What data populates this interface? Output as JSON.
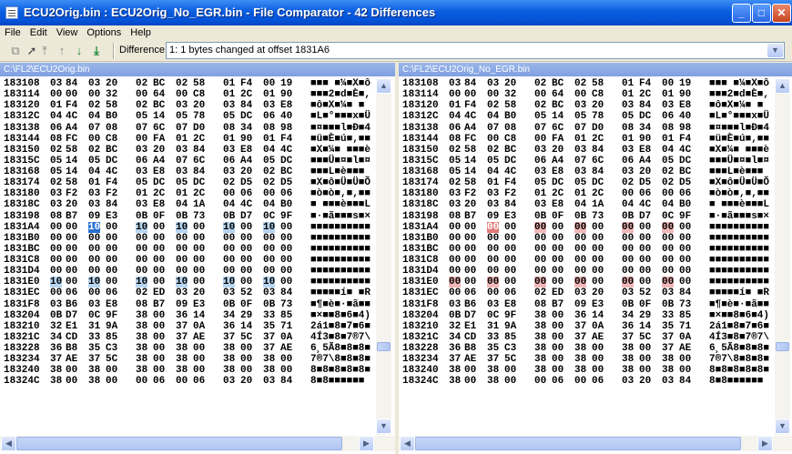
{
  "window": {
    "title": "ECU2Orig.bin : ECU2Orig_No_EGR.bin - File Comparator - 42 Differences"
  },
  "menu": [
    "File",
    "Edit",
    "View",
    "Options",
    "Help"
  ],
  "toolbar": {
    "difference_label": "Difference",
    "difference_value": "1: 1 bytes changed at offset 1831A6"
  },
  "left": {
    "path": "C:\\FL2\\ECU2Orig.bin",
    "rows": [
      {
        "addr": "183108",
        "bytes": [
          "03",
          "84",
          "03",
          "20",
          "02",
          "BC",
          "02",
          "58",
          "01",
          "F4",
          "00",
          "19"
        ],
        "ascii": "■■■ ■¼■X■ô"
      },
      {
        "addr": "183114",
        "bytes": [
          "00",
          "00",
          "00",
          "32",
          "00",
          "64",
          "00",
          "C8",
          "01",
          "2C",
          "01",
          "90"
        ],
        "ascii": "■■■2■d■È■,"
      },
      {
        "addr": "183120",
        "bytes": [
          "01",
          "F4",
          "02",
          "58",
          "02",
          "BC",
          "03",
          "20",
          "03",
          "84",
          "03",
          "E8"
        ],
        "ascii": "■ô■X■¼■ ■"
      },
      {
        "addr": "18312C",
        "bytes": [
          "04",
          "4C",
          "04",
          "B0",
          "05",
          "14",
          "05",
          "78",
          "05",
          "DC",
          "06",
          "40"
        ],
        "ascii": "■L■°■■■x■Ü"
      },
      {
        "addr": "183138",
        "bytes": [
          "06",
          "A4",
          "07",
          "08",
          "07",
          "6C",
          "07",
          "D0",
          "08",
          "34",
          "08",
          "98"
        ],
        "ascii": "■¤■■■l■Ð■4"
      },
      {
        "addr": "183144",
        "bytes": [
          "08",
          "FC",
          "00",
          "C8",
          "00",
          "FA",
          "01",
          "2C",
          "01",
          "90",
          "01",
          "F4"
        ],
        "ascii": "■ü■È■ú■,■■"
      },
      {
        "addr": "183150",
        "bytes": [
          "02",
          "58",
          "02",
          "BC",
          "03",
          "20",
          "03",
          "84",
          "03",
          "E8",
          "04",
          "4C"
        ],
        "ascii": "■X■¼■ ■■■è"
      },
      {
        "addr": "18315C",
        "bytes": [
          "05",
          "14",
          "05",
          "DC",
          "06",
          "A4",
          "07",
          "6C",
          "06",
          "A4",
          "05",
          "DC"
        ],
        "ascii": "■■■Ü■¤■l■¤"
      },
      {
        "addr": "183168",
        "bytes": [
          "05",
          "14",
          "04",
          "4C",
          "03",
          "E8",
          "03",
          "84",
          "03",
          "20",
          "02",
          "BC"
        ],
        "ascii": "■■■L■è■■■ "
      },
      {
        "addr": "183174",
        "bytes": [
          "02",
          "58",
          "01",
          "F4",
          "05",
          "DC",
          "05",
          "DC",
          "02",
          "D5",
          "02",
          "D5"
        ],
        "ascii": "■X■ô■Ü■Ü■Õ"
      },
      {
        "addr": "183180",
        "bytes": [
          "03",
          "F2",
          "03",
          "F2",
          "01",
          "2C",
          "01",
          "2C",
          "00",
          "06",
          "00",
          "06"
        ],
        "ascii": "■ò■ò■,■,■■"
      },
      {
        "addr": "18318C",
        "bytes": [
          "03",
          "20",
          "03",
          "84",
          "03",
          "E8",
          "04",
          "1A",
          "04",
          "4C",
          "04",
          "B0"
        ],
        "ascii": "■ ■■■è■■■L"
      },
      {
        "addr": "183198",
        "bytes": [
          "08",
          "B7",
          "09",
          "E3",
          "0B",
          "0F",
          "0B",
          "73",
          "0B",
          "D7",
          "0C",
          "9F"
        ],
        "ascii": "■·■ã■■■s■×"
      },
      {
        "addr": "1831A4",
        "bytes": [
          "00",
          "00",
          "10",
          "00",
          "10",
          "00",
          "10",
          "00",
          "10",
          "00",
          "10",
          "00"
        ],
        "ascii": "■■■■■■■■■■"
      },
      {
        "addr": "1831B0",
        "bytes": [
          "00",
          "00",
          "00",
          "00",
          "00",
          "00",
          "00",
          "00",
          "00",
          "00",
          "00",
          "00"
        ],
        "ascii": "■■■■■■■■■■"
      },
      {
        "addr": "1831BC",
        "bytes": [
          "00",
          "00",
          "00",
          "00",
          "00",
          "00",
          "00",
          "00",
          "00",
          "00",
          "00",
          "00"
        ],
        "ascii": "■■■■■■■■■■"
      },
      {
        "addr": "1831C8",
        "bytes": [
          "00",
          "00",
          "00",
          "00",
          "00",
          "00",
          "00",
          "00",
          "00",
          "00",
          "00",
          "00"
        ],
        "ascii": "■■■■■■■■■■"
      },
      {
        "addr": "1831D4",
        "bytes": [
          "00",
          "00",
          "00",
          "00",
          "00",
          "00",
          "00",
          "00",
          "00",
          "00",
          "00",
          "00"
        ],
        "ascii": "■■■■■■■■■■"
      },
      {
        "addr": "1831E0",
        "bytes": [
          "10",
          "00",
          "10",
          "00",
          "10",
          "00",
          "10",
          "00",
          "10",
          "00",
          "10",
          "00"
        ],
        "ascii": "■■■■■■■■■■"
      },
      {
        "addr": "1831EC",
        "bytes": [
          "00",
          "06",
          "00",
          "06",
          "02",
          "ED",
          "03",
          "20",
          "03",
          "52",
          "03",
          "84"
        ],
        "ascii": "■■■■■í■ ■R"
      },
      {
        "addr": "1831F8",
        "bytes": [
          "03",
          "B6",
          "03",
          "E8",
          "08",
          "B7",
          "09",
          "E3",
          "0B",
          "0F",
          "0B",
          "73"
        ],
        "ascii": "■¶■è■·■ã■■"
      },
      {
        "addr": "183204",
        "bytes": [
          "0B",
          "D7",
          "0C",
          "9F",
          "38",
          "00",
          "36",
          "14",
          "34",
          "29",
          "33",
          "85"
        ],
        "ascii": "■×■■8■6■4)"
      },
      {
        "addr": "183210",
        "bytes": [
          "32",
          "E1",
          "31",
          "9A",
          "38",
          "00",
          "37",
          "0A",
          "36",
          "14",
          "35",
          "71"
        ],
        "ascii": "2á1■8■7■6■"
      },
      {
        "addr": "18321C",
        "bytes": [
          "34",
          "CD",
          "33",
          "85",
          "38",
          "00",
          "37",
          "AE",
          "37",
          "5C",
          "37",
          "0A"
        ],
        "ascii": "4Í3■8■7®7\\"
      },
      {
        "addr": "183228",
        "bytes": [
          "36",
          "B8",
          "35",
          "C3",
          "38",
          "00",
          "38",
          "00",
          "38",
          "00",
          "37",
          "AE"
        ],
        "ascii": "6¸5Ã8■8■8■"
      },
      {
        "addr": "183234",
        "bytes": [
          "37",
          "AE",
          "37",
          "5C",
          "38",
          "00",
          "38",
          "00",
          "38",
          "00",
          "38",
          "00"
        ],
        "ascii": "7®7\\8■8■8■"
      },
      {
        "addr": "183240",
        "bytes": [
          "38",
          "00",
          "38",
          "00",
          "38",
          "00",
          "38",
          "00",
          "38",
          "00",
          "38",
          "00"
        ],
        "ascii": "8■8■8■8■8■"
      },
      {
        "addr": "18324C",
        "bytes": [
          "38",
          "00",
          "38",
          "00",
          "00",
          "06",
          "00",
          "06",
          "03",
          "20",
          "03",
          "84"
        ],
        "ascii": "8■8■■■■■■ "
      }
    ]
  },
  "right": {
    "path": "C:\\FL2\\ECU2Orig_No_EGR.bin",
    "rows": [
      {
        "addr": "183108",
        "bytes": [
          "03",
          "84",
          "03",
          "20",
          "02",
          "BC",
          "02",
          "58",
          "01",
          "F4",
          "00",
          "19"
        ],
        "ascii": "■■■ ■¼■X■ô"
      },
      {
        "addr": "183114",
        "bytes": [
          "00",
          "00",
          "00",
          "32",
          "00",
          "64",
          "00",
          "C8",
          "01",
          "2C",
          "01",
          "90"
        ],
        "ascii": "■■■2■d■È■,"
      },
      {
        "addr": "183120",
        "bytes": [
          "01",
          "F4",
          "02",
          "58",
          "02",
          "BC",
          "03",
          "20",
          "03",
          "84",
          "03",
          "E8"
        ],
        "ascii": "■ô■X■¼■ ■"
      },
      {
        "addr": "18312C",
        "bytes": [
          "04",
          "4C",
          "04",
          "B0",
          "05",
          "14",
          "05",
          "78",
          "05",
          "DC",
          "06",
          "40"
        ],
        "ascii": "■L■°■■■x■Ü"
      },
      {
        "addr": "183138",
        "bytes": [
          "06",
          "A4",
          "07",
          "08",
          "07",
          "6C",
          "07",
          "D0",
          "08",
          "34",
          "08",
          "98"
        ],
        "ascii": "■¤■■■l■Ð■4"
      },
      {
        "addr": "183144",
        "bytes": [
          "08",
          "FC",
          "00",
          "C8",
          "00",
          "FA",
          "01",
          "2C",
          "01",
          "90",
          "01",
          "F4"
        ],
        "ascii": "■ü■È■ú■,■■"
      },
      {
        "addr": "183150",
        "bytes": [
          "02",
          "58",
          "02",
          "BC",
          "03",
          "20",
          "03",
          "84",
          "03",
          "E8",
          "04",
          "4C"
        ],
        "ascii": "■X■¼■ ■■■è"
      },
      {
        "addr": "18315C",
        "bytes": [
          "05",
          "14",
          "05",
          "DC",
          "06",
          "A4",
          "07",
          "6C",
          "06",
          "A4",
          "05",
          "DC"
        ],
        "ascii": "■■■Ü■¤■l■¤"
      },
      {
        "addr": "183168",
        "bytes": [
          "05",
          "14",
          "04",
          "4C",
          "03",
          "E8",
          "03",
          "84",
          "03",
          "20",
          "02",
          "BC"
        ],
        "ascii": "■■■L■è■■■ "
      },
      {
        "addr": "183174",
        "bytes": [
          "02",
          "58",
          "01",
          "F4",
          "05",
          "DC",
          "05",
          "DC",
          "02",
          "D5",
          "02",
          "D5"
        ],
        "ascii": "■X■ô■Ü■Ü■Õ"
      },
      {
        "addr": "183180",
        "bytes": [
          "03",
          "F2",
          "03",
          "F2",
          "01",
          "2C",
          "01",
          "2C",
          "00",
          "06",
          "00",
          "06"
        ],
        "ascii": "■ò■ò■,■,■■"
      },
      {
        "addr": "18318C",
        "bytes": [
          "03",
          "20",
          "03",
          "84",
          "03",
          "E8",
          "04",
          "1A",
          "04",
          "4C",
          "04",
          "B0"
        ],
        "ascii": "■ ■■■è■■■L"
      },
      {
        "addr": "183198",
        "bytes": [
          "08",
          "B7",
          "09",
          "E3",
          "0B",
          "0F",
          "0B",
          "73",
          "0B",
          "D7",
          "0C",
          "9F"
        ],
        "ascii": "■·■ã■■■s■×"
      },
      {
        "addr": "1831A4",
        "bytes": [
          "00",
          "00",
          "00",
          "00",
          "00",
          "00",
          "00",
          "00",
          "00",
          "00",
          "00",
          "00"
        ],
        "ascii": "■■■■■■■■■■"
      },
      {
        "addr": "1831B0",
        "bytes": [
          "00",
          "00",
          "00",
          "00",
          "00",
          "00",
          "00",
          "00",
          "00",
          "00",
          "00",
          "00"
        ],
        "ascii": "■■■■■■■■■■"
      },
      {
        "addr": "1831BC",
        "bytes": [
          "00",
          "00",
          "00",
          "00",
          "00",
          "00",
          "00",
          "00",
          "00",
          "00",
          "00",
          "00"
        ],
        "ascii": "■■■■■■■■■■"
      },
      {
        "addr": "1831C8",
        "bytes": [
          "00",
          "00",
          "00",
          "00",
          "00",
          "00",
          "00",
          "00",
          "00",
          "00",
          "00",
          "00"
        ],
        "ascii": "■■■■■■■■■■"
      },
      {
        "addr": "1831D4",
        "bytes": [
          "00",
          "00",
          "00",
          "00",
          "00",
          "00",
          "00",
          "00",
          "00",
          "00",
          "00",
          "00"
        ],
        "ascii": "■■■■■■■■■■"
      },
      {
        "addr": "1831E0",
        "bytes": [
          "00",
          "00",
          "00",
          "00",
          "00",
          "00",
          "00",
          "00",
          "00",
          "00",
          "00",
          "00"
        ],
        "ascii": "■■■■■■■■■■"
      },
      {
        "addr": "1831EC",
        "bytes": [
          "00",
          "06",
          "00",
          "06",
          "02",
          "ED",
          "03",
          "20",
          "03",
          "52",
          "03",
          "84"
        ],
        "ascii": "■■■■■í■ ■R"
      },
      {
        "addr": "1831F8",
        "bytes": [
          "03",
          "B6",
          "03",
          "E8",
          "08",
          "B7",
          "09",
          "E3",
          "0B",
          "0F",
          "0B",
          "73"
        ],
        "ascii": "■¶■è■·■ã■■"
      },
      {
        "addr": "183204",
        "bytes": [
          "0B",
          "D7",
          "0C",
          "9F",
          "38",
          "00",
          "36",
          "14",
          "34",
          "29",
          "33",
          "85"
        ],
        "ascii": "■×■■8■6■4)"
      },
      {
        "addr": "183210",
        "bytes": [
          "32",
          "E1",
          "31",
          "9A",
          "38",
          "00",
          "37",
          "0A",
          "36",
          "14",
          "35",
          "71"
        ],
        "ascii": "2á1■8■7■6■"
      },
      {
        "addr": "18321C",
        "bytes": [
          "34",
          "CD",
          "33",
          "85",
          "38",
          "00",
          "37",
          "AE",
          "37",
          "5C",
          "37",
          "0A"
        ],
        "ascii": "4Í3■8■7®7\\"
      },
      {
        "addr": "183228",
        "bytes": [
          "36",
          "B8",
          "35",
          "C3",
          "38",
          "00",
          "38",
          "00",
          "38",
          "00",
          "37",
          "AE"
        ],
        "ascii": "6¸5Ã8■8■8■"
      },
      {
        "addr": "183234",
        "bytes": [
          "37",
          "AE",
          "37",
          "5C",
          "38",
          "00",
          "38",
          "00",
          "38",
          "00",
          "38",
          "00"
        ],
        "ascii": "7®7\\8■8■8■"
      },
      {
        "addr": "183240",
        "bytes": [
          "38",
          "00",
          "38",
          "00",
          "38",
          "00",
          "38",
          "00",
          "38",
          "00",
          "38",
          "00"
        ],
        "ascii": "8■8■8■8■8■"
      },
      {
        "addr": "18324C",
        "bytes": [
          "38",
          "00",
          "38",
          "00",
          "00",
          "06",
          "00",
          "06",
          "03",
          "20",
          "03",
          "84"
        ],
        "ascii": "8■8■■■■■■ "
      }
    ]
  },
  "colors": {
    "left_highlight": "#b7d5f1",
    "right_highlight": "#f2b7b7",
    "cursor": "#2a72d0"
  }
}
